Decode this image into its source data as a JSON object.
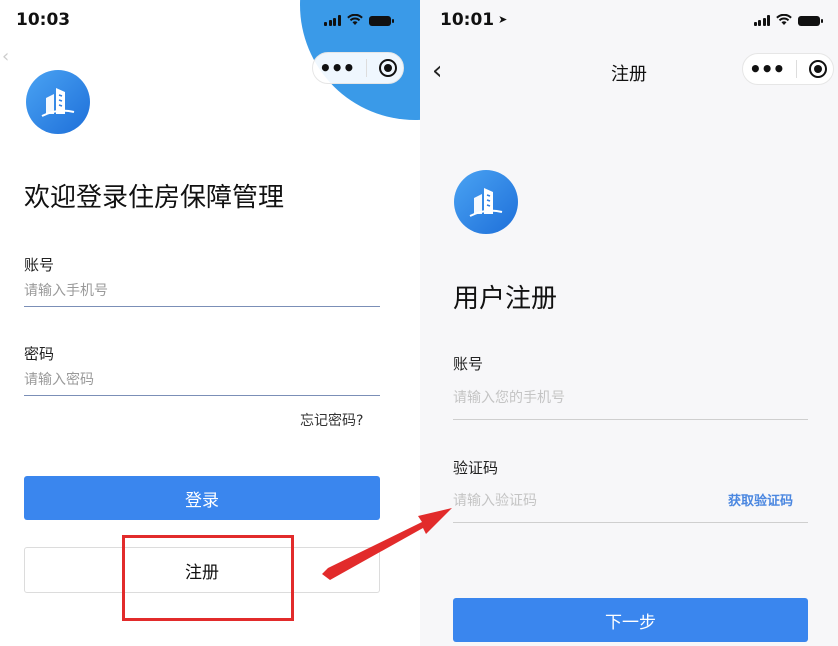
{
  "left": {
    "status_time": "10:03",
    "heading": "欢迎登录住房保障管理",
    "account_label": "账号",
    "account_placeholder": "请输入手机号",
    "password_label": "密码",
    "password_placeholder": "请输入密码",
    "forgot_link": "忘记密码?",
    "login_button": "登录",
    "register_button": "注册"
  },
  "right": {
    "status_time": "10:01",
    "nav_title": "注册",
    "heading": "用户注册",
    "account_label": "账号",
    "account_placeholder": "请输入您的手机号",
    "code_label": "验证码",
    "code_placeholder": "请输入验证码",
    "get_code_link": "获取验证码",
    "next_button": "下一步"
  },
  "colors": {
    "brand_blue": "#3a86ee",
    "highlight_red": "#e22b2b"
  },
  "icons": [
    "signal-icon",
    "wifi-icon",
    "battery-icon",
    "more-dots-icon",
    "mini-program-close-icon",
    "back-chevron-icon",
    "building-logo-icon"
  ]
}
